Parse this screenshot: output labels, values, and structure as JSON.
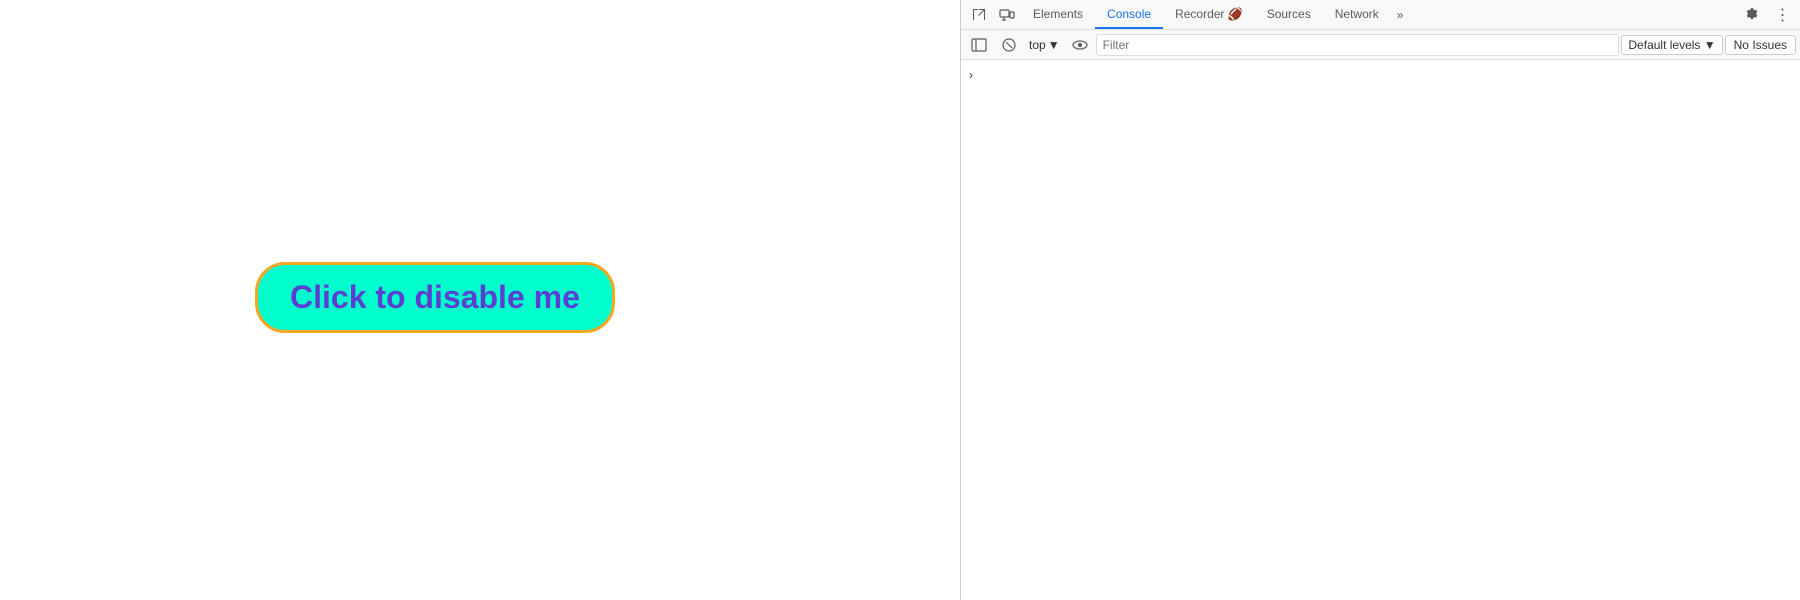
{
  "page": {
    "button_label": "Click to disable me"
  },
  "devtools": {
    "tabs": [
      {
        "id": "elements",
        "label": "Elements",
        "active": false
      },
      {
        "id": "console",
        "label": "Console",
        "active": true
      },
      {
        "id": "recorder",
        "label": "Recorder 🔴",
        "active": false
      },
      {
        "id": "sources",
        "label": "Sources",
        "active": false
      },
      {
        "id": "network",
        "label": "Network",
        "active": false
      }
    ],
    "more_tabs_label": "»",
    "console_bar": {
      "top_label": "top",
      "filter_placeholder": "Filter",
      "levels_label": "Default levels ▼",
      "no_issues_label": "No Issues"
    }
  }
}
